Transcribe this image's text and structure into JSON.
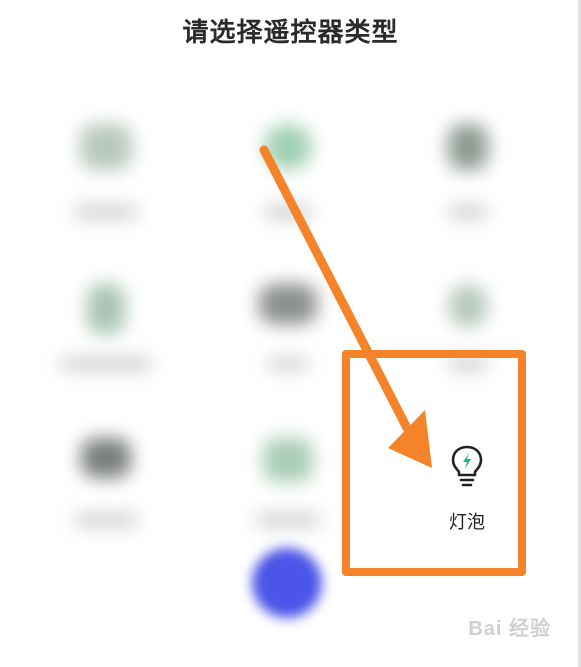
{
  "page": {
    "title": "请选择遥控器类型"
  },
  "remote_types": {
    "highlighted_item": {
      "label": "灯泡",
      "icon": "lightbulb-icon"
    },
    "blurred_items_count_note": "other remote types are blurred and unreadable"
  },
  "colors": {
    "highlight": "#f5832a",
    "fab": "#4b55e8",
    "icon_accent": "#1fb886"
  },
  "watermark": {
    "text": "Bai 经验"
  }
}
